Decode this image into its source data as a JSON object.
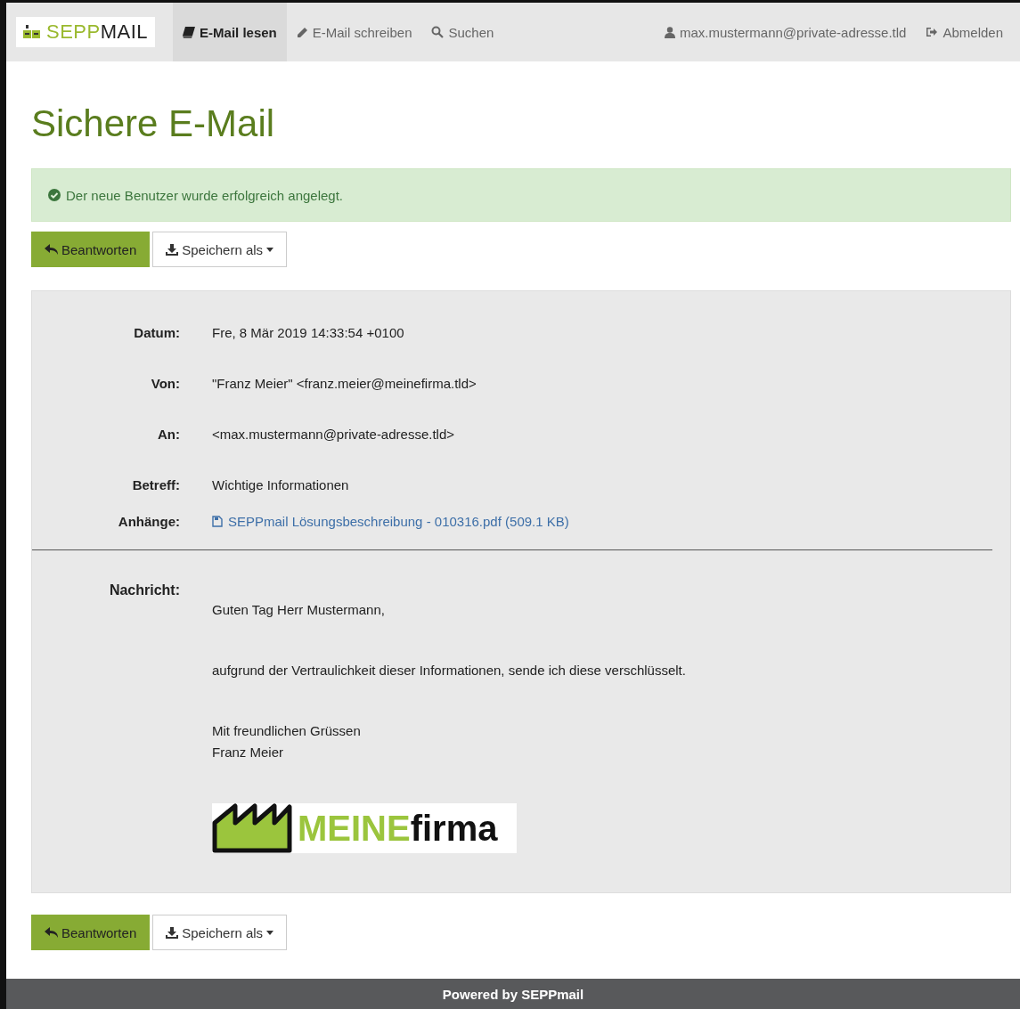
{
  "navbar": {
    "logo": "SEPP**MAIL**",
    "items": [
      {
        "label": "E-Mail lesen",
        "selected": true
      },
      {
        "label": "E-Mail schreiben",
        "selected": false
      },
      {
        "label": "Suchen",
        "selected": false
      }
    ],
    "user": "max.mustermann@private-adresse.tld",
    "logout": "Abmelden"
  },
  "title": "Sichere E-Mail",
  "alert": {
    "kind": "success",
    "text": "Der neue Benutzer wurde erfolgreich angelegt."
  },
  "toolbars": [
    {
      "buttons": [
        {
          "kind": "primary",
          "label": "Beantworten"
        },
        {
          "kind": "dropdown",
          "label": "Speichern als"
        }
      ]
    },
    {
      "buttons": [
        {
          "kind": "primary",
          "label": "Beantworten"
        },
        {
          "kind": "dropdown",
          "label": "Speichern als"
        }
      ]
    }
  ],
  "headers": [
    {
      "label": "Datum:",
      "value": "Fre, 8 Mär 2019 14:33:54 +0100"
    },
    {
      "label": "Von:",
      "value": "\"Franz Meier\" <franz.meier@meinefirma.tld>"
    },
    {
      "label": "An:",
      "value": "<max.mustermann@private-adresse.tld>"
    },
    {
      "label": "Betreff:",
      "value": "Wichtige Informationen"
    }
  ],
  "attachments": {
    "label": "Anhänge:",
    "files": [
      "SEPPmail Lösungsbeschreibung - 010316.pdf (509.1 KB)"
    ]
  },
  "message": {
    "label": "Nachricht:",
    "paragraphs": [
      [
        "Guten Tag Herr Mustermann,"
      ],
      [
        "aufgrund der Vertraulichkeit dieser Informationen, sende ich diese verschlüsselt."
      ],
      [
        "Mit freundlichen Grüssen",
        "Franz Meier"
      ]
    ],
    "signature_logo": "MEINE**firma**"
  },
  "footer": "Powered by SEPPmail"
}
